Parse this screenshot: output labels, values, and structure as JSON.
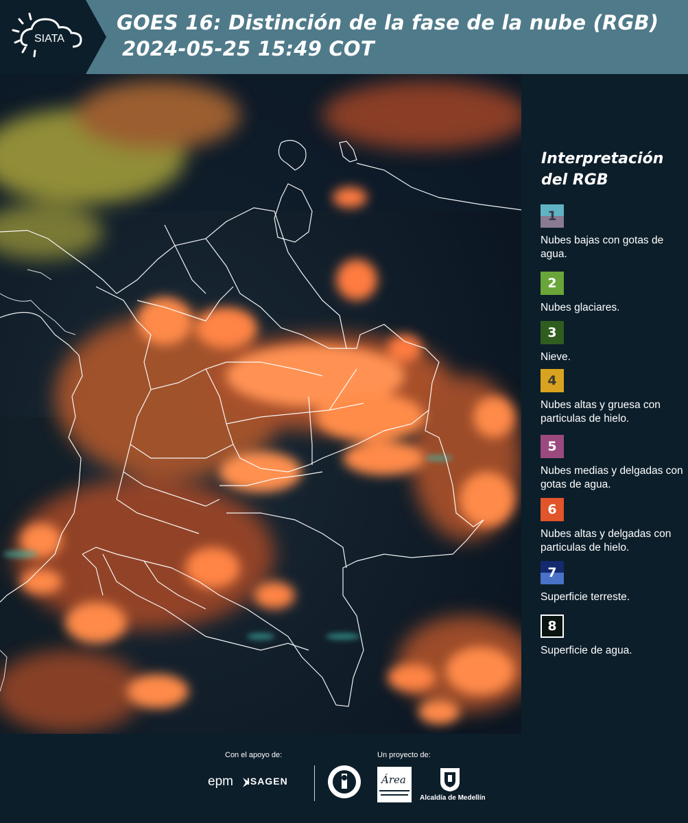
{
  "header": {
    "logo_text": "SIATA",
    "title_line1": "GOES 16: Distinción de la fase de la nube (RGB)",
    "title_line2": "2024-05-25 15:49 COT",
    "background_color": "#4f7a8a"
  },
  "legend": {
    "title_line1": "Interpretación",
    "title_line2": "del RGB",
    "items": [
      {
        "number": "1",
        "label": "Nubes bajas con gotas de agua.",
        "color_top": "#5fb3c3",
        "color_bottom": "#8a7a92"
      },
      {
        "number": "2",
        "label": "Nubes glaciares.",
        "color_top": "#6aa539",
        "color_bottom": "#6aa539"
      },
      {
        "number": "3",
        "label": "Nieve.",
        "color_top": "#2f5d1f",
        "color_bottom": "#2f5d1f"
      },
      {
        "number": "4",
        "label": "Nubes altas y gruesa con particulas de hielo.",
        "color_top": "#d9a31f",
        "color_bottom": "#d9a31f"
      },
      {
        "number": "5",
        "label": "Nubes medias y delgadas con gotas de agua.",
        "color_top": "#9a4a7e",
        "color_bottom": "#9a4a7e"
      },
      {
        "number": "6",
        "label": "Nubes altas y delgadas con particulas de hielo.",
        "color_top": "#e2542a",
        "color_bottom": "#e2542a"
      },
      {
        "number": "7",
        "label": "Superficie terreste.",
        "color_top": "#142a6e",
        "color_bottom": "#4a72c9"
      },
      {
        "number": "8",
        "label": "Superficie de agua.",
        "color_top": "#0a1410",
        "color_bottom": "#0a1410"
      }
    ]
  },
  "footer": {
    "support_label": "Con el apoyo de:",
    "project_label": "Un proyecto de:",
    "sponsors": [
      "epm",
      "ISAGEN"
    ],
    "partners": [
      "Universidad Nacional de Colombia",
      "Área Metropolitana Valle de Aburrá",
      "Alcaldía de Medellín"
    ],
    "alcaldia_text": "Alcaldía de Medellín",
    "area_text": "Área"
  }
}
